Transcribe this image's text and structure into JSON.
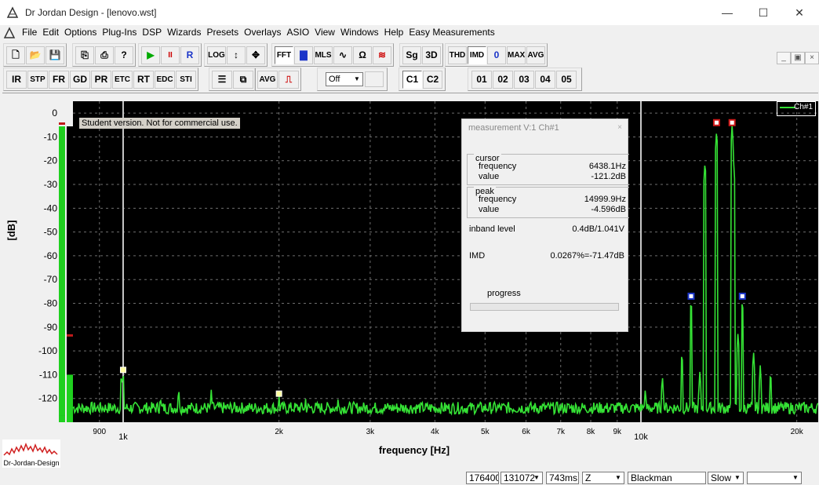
{
  "window": {
    "title": "Dr Jordan Design - [lenovo.wst]",
    "minimize_glyph": "—",
    "maximize_glyph": "☐",
    "close_glyph": "✕"
  },
  "menu": {
    "items": [
      "File",
      "Edit",
      "Options",
      "Plug-Ins",
      "DSP",
      "Wizards",
      "Presets",
      "Overlays",
      "ASIO",
      "View",
      "Windows",
      "Help",
      "Easy Measurements"
    ],
    "mdi_min": "_",
    "mdi_restore": "▣",
    "mdi_close": "×"
  },
  "toolbar1": {
    "buttons": [
      {
        "id": "new",
        "icon": "new-file-icon",
        "glyph": "🗋"
      },
      {
        "id": "open",
        "icon": "open-folder-icon",
        "glyph": "📂"
      },
      {
        "id": "save",
        "icon": "save-disk-icon",
        "glyph": "💾"
      },
      {
        "id": "copy",
        "icon": "copy-icon",
        "glyph": "⎘"
      },
      {
        "id": "print",
        "icon": "printer-icon",
        "glyph": "⎙"
      },
      {
        "id": "help",
        "icon": "help-icon",
        "glyph": "?"
      },
      {
        "id": "play",
        "icon": "play-icon",
        "glyph": "▶"
      },
      {
        "id": "pause",
        "icon": "pause-icon",
        "glyph": "II"
      },
      {
        "id": "r",
        "label": "R"
      },
      {
        "id": "log",
        "label": "LOG"
      },
      {
        "id": "vscale",
        "icon": "vertical-arrows-icon",
        "glyph": "↕"
      },
      {
        "id": "move",
        "icon": "move-icon",
        "glyph": "✥"
      },
      {
        "id": "fft",
        "label": "FFT"
      },
      {
        "id": "bars",
        "icon": "bar-spectrum-icon",
        "glyph": "▇"
      },
      {
        "id": "mls",
        "label": "MLS"
      },
      {
        "id": "wave",
        "icon": "waveform-icon",
        "glyph": "∿"
      },
      {
        "id": "ohm",
        "label": "Ω"
      },
      {
        "id": "speaker",
        "icon": "speaker-curve-icon",
        "glyph": "≋"
      },
      {
        "id": "sg",
        "label": "Sg"
      },
      {
        "id": "3d",
        "label": "3D"
      },
      {
        "id": "thd",
        "label": "THD"
      },
      {
        "id": "imd",
        "label": "IMD"
      },
      {
        "id": "zero",
        "label": "0"
      },
      {
        "id": "max",
        "label": "MAX"
      },
      {
        "id": "avg",
        "label": "AVG"
      }
    ]
  },
  "toolbar2": {
    "buttons": [
      {
        "id": "ir",
        "label": "IR"
      },
      {
        "id": "stp",
        "label": "STP"
      },
      {
        "id": "fr",
        "label": "FR"
      },
      {
        "id": "gd",
        "label": "GD"
      },
      {
        "id": "pr",
        "label": "PR"
      },
      {
        "id": "etc",
        "label": "ETC"
      },
      {
        "id": "rt",
        "label": "RT"
      },
      {
        "id": "edc",
        "label": "EDC"
      },
      {
        "id": "sti",
        "label": "STI"
      },
      {
        "id": "export",
        "icon": "export-icon",
        "glyph": "☰"
      },
      {
        "id": "windows",
        "icon": "windows-icon",
        "glyph": "⧉"
      },
      {
        "id": "avg2",
        "label": "AVG"
      },
      {
        "id": "pulse",
        "icon": "pulse-icon",
        "glyph": "⎍"
      }
    ],
    "select_value": "Off",
    "channels": [
      "C1",
      "C2"
    ],
    "slots": [
      "01",
      "02",
      "03",
      "04",
      "05"
    ]
  },
  "graph": {
    "student_note": "Student version. Not for commercial use.",
    "legend": "Ch#1",
    "xlabel": "frequency [Hz]",
    "ylabel": "[dB]",
    "logo_text": "Dr-Jordan-Design"
  },
  "measurement": {
    "title": "measurement V:1 Ch#1",
    "close_glyph": "×",
    "cursor_title": "cursor",
    "peak_title": "peak",
    "frequency_label": "frequency",
    "value_label": "value",
    "cursor_frequency": "6438.1Hz",
    "cursor_value": "-121.2dB",
    "peak_frequency": "14999.9Hz",
    "peak_value": "-4.596dB",
    "inband_label": "inband level",
    "inband_value": "0.4dB/1.041V",
    "imd_label": "IMD",
    "imd_value": "0.0267%=-71.47dB",
    "progress_label": "progress",
    "progress": 0
  },
  "status": {
    "sample_rate": "176400",
    "fft_size": "131072",
    "time": "743ms",
    "z": "Z",
    "window": "Blackman",
    "speed": "Slow",
    "extra": ""
  },
  "colors": {
    "plot_bg": "#000000",
    "trace": "#35e135",
    "grid": "#6e6e6e",
    "meter_green": "#1fd01f",
    "marker_red": "#d11a1a",
    "marker_blue": "#1a34c8",
    "marker_yellow": "#ffffa0"
  },
  "chart_data": {
    "type": "line",
    "title": "",
    "xlabel": "frequency [Hz]",
    "ylabel": "[dB]",
    "xscale": "log",
    "xlim": [
      800,
      22000
    ],
    "ylim": [
      -130,
      5
    ],
    "y_ticks": [
      0,
      -10,
      -20,
      -30,
      -40,
      -50,
      -60,
      -70,
      -80,
      -90,
      -100,
      -110,
      -120
    ],
    "x_ticks": [
      {
        "v": 900,
        "label": "900"
      },
      {
        "v": 1000,
        "label": "1k"
      },
      {
        "v": 2000,
        "label": "2k"
      },
      {
        "v": 3000,
        "label": "3k"
      },
      {
        "v": 4000,
        "label": "4k"
      },
      {
        "v": 5000,
        "label": "5k"
      },
      {
        "v": 6000,
        "label": "6k"
      },
      {
        "v": 7000,
        "label": "7k"
      },
      {
        "v": 8000,
        "label": "8k"
      },
      {
        "v": 9000,
        "label": "9k"
      },
      {
        "v": 10000,
        "label": "10k"
      },
      {
        "v": 20000,
        "label": "20k"
      }
    ],
    "grid": true,
    "legend": "top-right",
    "series": [
      {
        "name": "Ch#1"
      }
    ],
    "noise_floor_db": -124,
    "peaks": [
      {
        "f": 992,
        "db": -109
      },
      {
        "f": 1000,
        "db": -108
      },
      {
        "f": 1180,
        "db": -118
      },
      {
        "f": 1280,
        "db": -115
      },
      {
        "f": 1480,
        "db": -116
      },
      {
        "f": 2000,
        "db": -118
      },
      {
        "f": 2250,
        "db": -119
      },
      {
        "f": 2600,
        "db": -120
      },
      {
        "f": 10200,
        "db": -115
      },
      {
        "f": 11000,
        "db": -110
      },
      {
        "f": 12000,
        "db": -100
      },
      {
        "f": 12500,
        "db": -78
      },
      {
        "f": 13000,
        "db": -108
      },
      {
        "f": 13300,
        "db": -20
      },
      {
        "f": 14000,
        "db": -7
      },
      {
        "f": 14999,
        "db": -5
      },
      {
        "f": 15100,
        "db": -20
      },
      {
        "f": 15400,
        "db": -92
      },
      {
        "f": 15700,
        "db": -78
      },
      {
        "f": 16500,
        "db": -100
      },
      {
        "f": 17000,
        "db": -106
      },
      {
        "f": 17800,
        "db": -108
      }
    ],
    "markers": [
      {
        "f": 1000,
        "db": -108,
        "color": "marker_yellow"
      },
      {
        "f": 2000,
        "db": -118,
        "color": "marker_yellow"
      },
      {
        "f": 14000,
        "db": -4,
        "color": "marker_red"
      },
      {
        "f": 14999,
        "db": -4,
        "color": "marker_red"
      },
      {
        "f": 12500,
        "db": -77,
        "color": "marker_blue"
      },
      {
        "f": 15700,
        "db": -77,
        "color": "marker_blue"
      }
    ],
    "cursors": [
      1000,
      10000
    ],
    "meter_left_db": -128,
    "meter_right_db": -110
  }
}
